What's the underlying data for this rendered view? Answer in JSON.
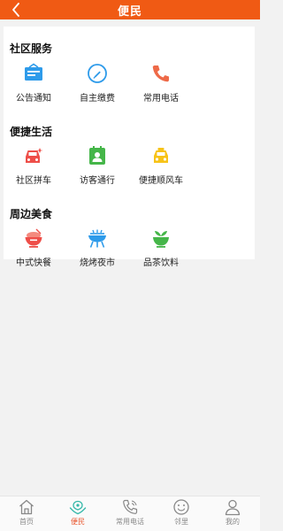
{
  "header": {
    "title": "便民"
  },
  "sections": [
    {
      "title": "社区服务",
      "items": [
        {
          "label": "公告通知",
          "icon": "announcement-icon"
        },
        {
          "label": "自主缴费",
          "icon": "payment-icon"
        },
        {
          "label": "常用电话",
          "icon": "phone-icon"
        }
      ]
    },
    {
      "title": "便捷生活",
      "items": [
        {
          "label": "社区拼车",
          "icon": "carpool-icon"
        },
        {
          "label": "访客通行",
          "icon": "visitor-pass-icon"
        },
        {
          "label": "便捷顺风车",
          "icon": "taxi-icon"
        }
      ]
    },
    {
      "title": "周边美食",
      "items": [
        {
          "label": "中式快餐",
          "icon": "rice-bowl-icon"
        },
        {
          "label": "烧烤夜市",
          "icon": "barbecue-grill-icon"
        },
        {
          "label": "品茶饮料",
          "icon": "tea-icon"
        }
      ]
    }
  ],
  "tabbar": {
    "tabs": [
      {
        "label": "首页",
        "icon": "home-icon",
        "active": false
      },
      {
        "label": "便民",
        "icon": "convenience-icon",
        "active": true
      },
      {
        "label": "常用电话",
        "icon": "phone-outline-icon",
        "active": false
      },
      {
        "label": "邻里",
        "icon": "smiley-icon",
        "active": false
      },
      {
        "label": "我的",
        "icon": "user-icon",
        "active": false
      }
    ]
  },
  "colors": {
    "header": "#f05a14",
    "active_tab": "#e8532a",
    "blue": "#2e9bea",
    "red": "#ee4e48",
    "green": "#45b649",
    "yellow": "#f7c318",
    "teal": "#35b8a9"
  }
}
